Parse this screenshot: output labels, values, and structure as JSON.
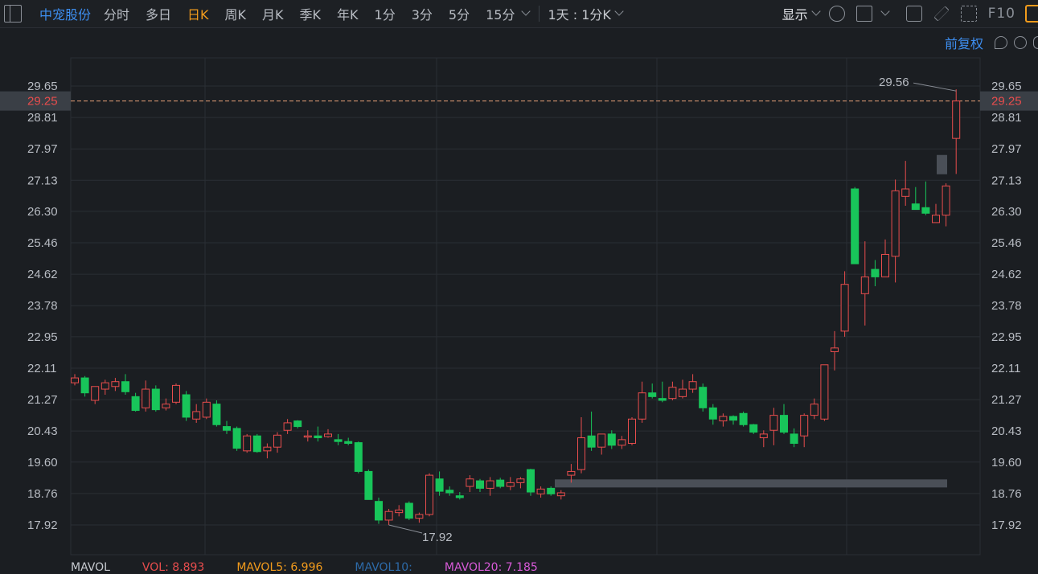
{
  "toolbar": {
    "stock_name": "中宠股份",
    "tabs": [
      {
        "label": "分时",
        "active": false
      },
      {
        "label": "多日",
        "active": false
      },
      {
        "label": "日K",
        "active": true
      },
      {
        "label": "周K",
        "active": false
      },
      {
        "label": "月K",
        "active": false
      },
      {
        "label": "季K",
        "active": false
      },
      {
        "label": "年K",
        "active": false
      },
      {
        "label": "1分",
        "active": false
      },
      {
        "label": "3分",
        "active": false
      },
      {
        "label": "5分",
        "active": false
      },
      {
        "label": "15分",
        "active": false
      }
    ],
    "period_label": "1天 : 1分K",
    "show_label": "显示",
    "f10_label": "F10",
    "icons": [
      "gear-icon",
      "square-icon",
      "camera-icon",
      "pencil-icon",
      "fullscreen-icon"
    ]
  },
  "subbar": {
    "adjust_label": "前复权"
  },
  "bottom": {
    "mavol_label": "MAVOL",
    "vol_label": "VOL: 8.893",
    "mavol5_label": "MAVOL5: 6.996",
    "mavol10_label": "MAVOL10:",
    "mavol20_label": "MAVOL20: 7.185"
  },
  "colors": {
    "up": "#e84d4d",
    "down": "#18c55a",
    "accent": "#f29b1c",
    "link": "#3d8ef0",
    "current_price": "#e84d4d"
  },
  "chart_data": {
    "type": "candlestick",
    "y_ticks": [
      "29.65",
      "28.81",
      "27.97",
      "27.13",
      "26.30",
      "25.46",
      "24.62",
      "23.78",
      "22.95",
      "22.11",
      "21.27",
      "20.43",
      "19.60",
      "18.76",
      "17.92"
    ],
    "current_price": "29.25",
    "max_label": "29.56",
    "min_label": "17.92",
    "ylim": [
      17.92,
      29.65
    ],
    "candles": [
      {
        "o": 21.72,
        "h": 21.95,
        "l": 21.65,
        "c": 21.85
      },
      {
        "o": 21.85,
        "h": 21.9,
        "l": 21.35,
        "c": 21.45
      },
      {
        "o": 21.25,
        "h": 21.6,
        "l": 21.15,
        "c": 21.62
      },
      {
        "o": 21.55,
        "h": 21.8,
        "l": 21.4,
        "c": 21.72
      },
      {
        "o": 21.62,
        "h": 21.85,
        "l": 21.5,
        "c": 21.75
      },
      {
        "o": 21.75,
        "h": 21.95,
        "l": 21.4,
        "c": 21.48
      },
      {
        "o": 21.35,
        "h": 21.45,
        "l": 20.95,
        "c": 20.98
      },
      {
        "o": 21.05,
        "h": 21.78,
        "l": 20.95,
        "c": 21.55
      },
      {
        "o": 21.55,
        "h": 21.65,
        "l": 20.95,
        "c": 21.0
      },
      {
        "o": 21.05,
        "h": 21.3,
        "l": 20.98,
        "c": 21.15
      },
      {
        "o": 21.2,
        "h": 21.7,
        "l": 21.15,
        "c": 21.65
      },
      {
        "o": 21.4,
        "h": 21.5,
        "l": 20.7,
        "c": 20.8
      },
      {
        "o": 20.75,
        "h": 21.15,
        "l": 20.65,
        "c": 20.95
      },
      {
        "o": 20.8,
        "h": 21.3,
        "l": 20.75,
        "c": 21.2
      },
      {
        "o": 21.15,
        "h": 21.25,
        "l": 20.55,
        "c": 20.6
      },
      {
        "o": 20.55,
        "h": 20.7,
        "l": 20.35,
        "c": 20.45
      },
      {
        "o": 20.5,
        "h": 20.55,
        "l": 19.9,
        "c": 19.97
      },
      {
        "o": 19.9,
        "h": 20.35,
        "l": 19.85,
        "c": 20.3
      },
      {
        "o": 20.3,
        "h": 20.35,
        "l": 19.85,
        "c": 19.88
      },
      {
        "o": 19.9,
        "h": 20.1,
        "l": 19.7,
        "c": 20.0
      },
      {
        "o": 20.0,
        "h": 20.4,
        "l": 19.85,
        "c": 20.32
      },
      {
        "o": 20.45,
        "h": 20.75,
        "l": 20.35,
        "c": 20.65
      },
      {
        "o": 20.7,
        "h": 20.72,
        "l": 20.5,
        "c": 20.55
      },
      {
        "o": 20.28,
        "h": 20.45,
        "l": 20.15,
        "c": 20.3
      },
      {
        "o": 20.3,
        "h": 20.55,
        "l": 20.15,
        "c": 20.25
      },
      {
        "o": 20.28,
        "h": 20.48,
        "l": 20.25,
        "c": 20.35
      },
      {
        "o": 20.2,
        "h": 20.35,
        "l": 20.05,
        "c": 20.15
      },
      {
        "o": 20.15,
        "h": 20.25,
        "l": 20.05,
        "c": 20.1
      },
      {
        "o": 20.12,
        "h": 20.15,
        "l": 19.3,
        "c": 19.35
      },
      {
        "o": 19.35,
        "h": 19.4,
        "l": 18.6,
        "c": 18.6
      },
      {
        "o": 18.55,
        "h": 18.65,
        "l": 17.95,
        "c": 18.05
      },
      {
        "o": 18.05,
        "h": 18.35,
        "l": 17.92,
        "c": 18.28
      },
      {
        "o": 18.25,
        "h": 18.45,
        "l": 18.15,
        "c": 18.32
      },
      {
        "o": 18.5,
        "h": 18.55,
        "l": 18.05,
        "c": 18.1
      },
      {
        "o": 18.1,
        "h": 18.25,
        "l": 17.98,
        "c": 18.2
      },
      {
        "o": 18.2,
        "h": 19.3,
        "l": 18.15,
        "c": 19.25
      },
      {
        "o": 19.15,
        "h": 19.35,
        "l": 18.7,
        "c": 18.82
      },
      {
        "o": 18.85,
        "h": 18.95,
        "l": 18.7,
        "c": 18.78
      },
      {
        "o": 18.7,
        "h": 18.8,
        "l": 18.6,
        "c": 18.65
      },
      {
        "o": 18.95,
        "h": 19.25,
        "l": 18.8,
        "c": 19.15
      },
      {
        "o": 19.1,
        "h": 19.15,
        "l": 18.8,
        "c": 18.9
      },
      {
        "o": 18.9,
        "h": 19.2,
        "l": 18.7,
        "c": 19.1
      },
      {
        "o": 19.12,
        "h": 19.18,
        "l": 18.9,
        "c": 18.95
      },
      {
        "o": 18.95,
        "h": 19.2,
        "l": 18.85,
        "c": 19.05
      },
      {
        "o": 19.05,
        "h": 19.2,
        "l": 18.9,
        "c": 19.15
      },
      {
        "o": 19.4,
        "h": 19.42,
        "l": 18.7,
        "c": 18.8
      },
      {
        "o": 18.75,
        "h": 18.95,
        "l": 18.65,
        "c": 18.88
      },
      {
        "o": 18.9,
        "h": 18.95,
        "l": 18.7,
        "c": 18.75
      },
      {
        "o": 18.7,
        "h": 18.85,
        "l": 18.6,
        "c": 18.78
      },
      {
        "o": 19.25,
        "h": 19.55,
        "l": 19.05,
        "c": 19.35
      },
      {
        "o": 19.4,
        "h": 20.8,
        "l": 19.3,
        "c": 20.25
      },
      {
        "o": 20.3,
        "h": 20.95,
        "l": 19.9,
        "c": 20.0
      },
      {
        "o": 20.0,
        "h": 20.35,
        "l": 19.8,
        "c": 20.35
      },
      {
        "o": 20.35,
        "h": 20.45,
        "l": 19.95,
        "c": 20.05
      },
      {
        "o": 20.05,
        "h": 20.3,
        "l": 19.95,
        "c": 20.2
      },
      {
        "o": 20.1,
        "h": 20.8,
        "l": 20.05,
        "c": 20.75
      },
      {
        "o": 20.75,
        "h": 21.75,
        "l": 20.65,
        "c": 21.45
      },
      {
        "o": 21.45,
        "h": 21.7,
        "l": 21.3,
        "c": 21.35
      },
      {
        "o": 21.3,
        "h": 21.75,
        "l": 21.2,
        "c": 21.25
      },
      {
        "o": 21.3,
        "h": 21.75,
        "l": 21.25,
        "c": 21.6
      },
      {
        "o": 21.35,
        "h": 21.8,
        "l": 21.3,
        "c": 21.55
      },
      {
        "o": 21.55,
        "h": 21.95,
        "l": 21.45,
        "c": 21.75
      },
      {
        "o": 21.6,
        "h": 21.7,
        "l": 20.95,
        "c": 21.05
      },
      {
        "o": 21.05,
        "h": 21.15,
        "l": 20.6,
        "c": 20.75
      },
      {
        "o": 20.7,
        "h": 20.9,
        "l": 20.55,
        "c": 20.82
      },
      {
        "o": 20.82,
        "h": 20.85,
        "l": 20.6,
        "c": 20.72
      },
      {
        "o": 20.9,
        "h": 20.95,
        "l": 20.55,
        "c": 20.6
      },
      {
        "o": 20.6,
        "h": 20.62,
        "l": 20.35,
        "c": 20.4
      },
      {
        "o": 20.25,
        "h": 20.45,
        "l": 20.0,
        "c": 20.35
      },
      {
        "o": 20.45,
        "h": 21.05,
        "l": 20.05,
        "c": 20.85
      },
      {
        "o": 20.85,
        "h": 21.15,
        "l": 20.35,
        "c": 20.4
      },
      {
        "o": 20.35,
        "h": 20.5,
        "l": 20.0,
        "c": 20.1
      },
      {
        "o": 20.3,
        "h": 20.9,
        "l": 20.0,
        "c": 20.85
      },
      {
        "o": 20.85,
        "h": 21.3,
        "l": 20.75,
        "c": 21.15
      },
      {
        "o": 20.75,
        "h": 22.2,
        "l": 20.7,
        "c": 22.2
      },
      {
        "o": 22.55,
        "h": 23.1,
        "l": 22.05,
        "c": 22.65
      },
      {
        "o": 23.1,
        "h": 24.7,
        "l": 22.95,
        "c": 24.35
      },
      {
        "o": 26.9,
        "h": 26.95,
        "l": 24.9,
        "c": 24.9
      },
      {
        "o": 24.1,
        "h": 25.5,
        "l": 23.25,
        "c": 24.55
      },
      {
        "o": 24.75,
        "h": 25.0,
        "l": 24.3,
        "c": 24.55
      },
      {
        "o": 24.55,
        "h": 25.55,
        "l": 24.55,
        "c": 25.15
      },
      {
        "o": 25.1,
        "h": 27.15,
        "l": 24.4,
        "c": 26.85
      },
      {
        "o": 26.7,
        "h": 27.65,
        "l": 26.45,
        "c": 26.9
      },
      {
        "o": 26.5,
        "h": 26.95,
        "l": 26.35,
        "c": 26.35
      },
      {
        "o": 26.4,
        "h": 27.1,
        "l": 26.2,
        "c": 26.25
      },
      {
        "o": 26.0,
        "h": 26.5,
        "l": 26.0,
        "c": 26.2
      },
      {
        "o": 26.2,
        "h": 27.05,
        "l": 25.9,
        "c": 26.98
      },
      {
        "o": 28.25,
        "h": 29.56,
        "l": 27.3,
        "c": 29.25
      }
    ],
    "volume_range_bar": {
      "price": 19.03
    }
  }
}
